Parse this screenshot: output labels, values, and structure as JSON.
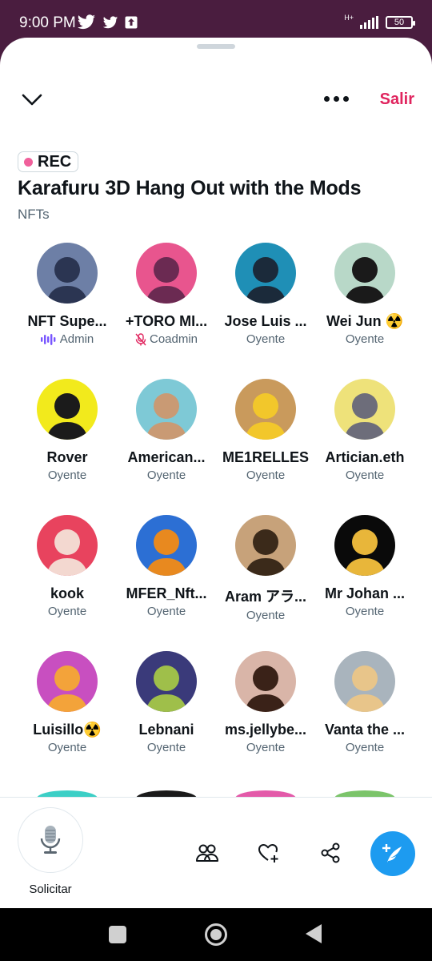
{
  "status_bar": {
    "time": "9:00 PM",
    "network": "H+",
    "battery": "50"
  },
  "header": {
    "leave_label": "Salir"
  },
  "space": {
    "rec_label": "REC",
    "title": "Karafuru 3D Hang Out with the Mods",
    "topic": "NFTs"
  },
  "participants": [
    {
      "name": "NFT Supe...",
      "role": "Admin",
      "role_icon": "speaking-icon",
      "bg": "#6d7fa6",
      "fg": "#2b3552"
    },
    {
      "name": "+TORO MI...",
      "role": "Coadmin",
      "role_icon": "mic-muted-icon",
      "bg": "#e8558e",
      "fg": "#6b2a52"
    },
    {
      "name": "Jose Luis ...",
      "role": "Oyente",
      "role_icon": "",
      "bg": "#1f8fb6",
      "fg": "#1b2a3a"
    },
    {
      "name": "Wei Jun ☢️",
      "role": "Oyente",
      "role_icon": "",
      "bg": "#b8d8c8",
      "fg": "#1a1a1a"
    },
    {
      "name": "Rover",
      "role": "Oyente",
      "role_icon": "",
      "bg": "#f2ea1c",
      "fg": "#1b1b1b"
    },
    {
      "name": "American...",
      "role": "Oyente",
      "role_icon": "",
      "bg": "#7ec9d6",
      "fg": "#c99a74"
    },
    {
      "name": "ME1RELLES",
      "role": "Oyente",
      "role_icon": "",
      "bg": "#c99a5c",
      "fg": "#f2c72b"
    },
    {
      "name": "Artician.eth",
      "role": "Oyente",
      "role_icon": "",
      "bg": "#eee27a",
      "fg": "#6d6d7a"
    },
    {
      "name": "kook",
      "role": "Oyente",
      "role_icon": "",
      "bg": "#e8435e",
      "fg": "#f3d8d0"
    },
    {
      "name": "MFER_Nft...",
      "role": "Oyente",
      "role_icon": "",
      "bg": "#2c6fd4",
      "fg": "#e8891f"
    },
    {
      "name": "Aram アラ...",
      "role": "Oyente",
      "role_icon": "",
      "bg": "#c7a27a",
      "fg": "#3b2a1a"
    },
    {
      "name": "Mr Johan ...",
      "role": "Oyente",
      "role_icon": "",
      "bg": "#0a0a0a",
      "fg": "#e8b63a"
    },
    {
      "name": "Luisillo☢️",
      "role": "Oyente",
      "role_icon": "",
      "bg": "#c84fc0",
      "fg": "#f3a33a"
    },
    {
      "name": "Lebnani",
      "role": "Oyente",
      "role_icon": "",
      "bg": "#3a3a7a",
      "fg": "#9fbf4a"
    },
    {
      "name": "ms.jellybe...",
      "role": "Oyente",
      "role_icon": "",
      "bg": "#d9b5a8",
      "fg": "#3a2218"
    },
    {
      "name": "Vanta the ...",
      "role": "Oyente",
      "role_icon": "",
      "bg": "#a9b4bd",
      "fg": "#e8c58a"
    }
  ],
  "partial_avatars": [
    "#3ccfc6",
    "#1a1a1a",
    "#e35aa9",
    "#7bc46a"
  ],
  "bottom": {
    "mic_label": "Solicitar"
  },
  "colors": {
    "accent": "#e0245e",
    "brand": "#1d9bf0",
    "header_bg": "#4a1d3f"
  }
}
